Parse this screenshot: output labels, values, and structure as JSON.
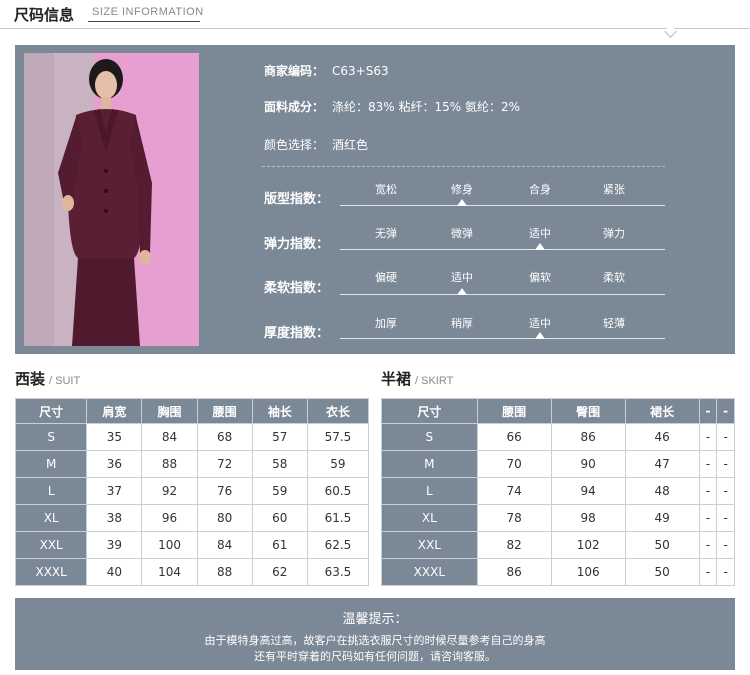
{
  "header": {
    "title": "尺码信息",
    "subtitle": "SIZE INFORMATION"
  },
  "product": {
    "code_label": "商家编码：",
    "code_value": "C63+S63",
    "fabric_label": "面料成分：",
    "fabric_value": "涤纶：83% 粘纤：15% 氨纶：2%",
    "color_label": "颜色选择：",
    "color_value": "酒红色"
  },
  "scales": [
    {
      "label": "版型指数：",
      "options": [
        "宽松",
        "修身",
        "合身",
        "紧张"
      ],
      "selected_index": 1
    },
    {
      "label": "弹力指数：",
      "options": [
        "无弹",
        "微弹",
        "适中",
        "弹力"
      ],
      "selected_index": 2
    },
    {
      "label": "柔软指数：",
      "options": [
        "偏硬",
        "适中",
        "偏软",
        "柔软"
      ],
      "selected_index": 1
    },
    {
      "label": "厚度指数：",
      "options": [
        "加厚",
        "稍厚",
        "适中",
        "轻薄"
      ],
      "selected_index": 2
    }
  ],
  "suit": {
    "title": "西装",
    "subtitle": "/ SUIT",
    "headers": [
      "尺寸",
      "肩宽",
      "胸围",
      "腰围",
      "袖长",
      "衣长"
    ],
    "rows": [
      [
        "S",
        "35",
        "84",
        "68",
        "57",
        "57.5"
      ],
      [
        "M",
        "36",
        "88",
        "72",
        "58",
        "59"
      ],
      [
        "L",
        "37",
        "92",
        "76",
        "59",
        "60.5"
      ],
      [
        "XL",
        "38",
        "96",
        "80",
        "60",
        "61.5"
      ],
      [
        "XXL",
        "39",
        "100",
        "84",
        "61",
        "62.5"
      ],
      [
        "XXXL",
        "40",
        "104",
        "88",
        "62",
        "63.5"
      ]
    ]
  },
  "skirt": {
    "title": "半裙",
    "subtitle": "/ SKIRT",
    "headers": [
      "尺寸",
      "腰围",
      "臀围",
      "裙长",
      "-",
      "-"
    ],
    "rows": [
      [
        "S",
        "66",
        "86",
        "46",
        "-",
        "-"
      ],
      [
        "M",
        "70",
        "90",
        "47",
        "-",
        "-"
      ],
      [
        "L",
        "74",
        "94",
        "48",
        "-",
        "-"
      ],
      [
        "XL",
        "78",
        "98",
        "49",
        "-",
        "-"
      ],
      [
        "XXL",
        "82",
        "102",
        "50",
        "-",
        "-"
      ],
      [
        "XXXL",
        "86",
        "106",
        "50",
        "-",
        "-"
      ]
    ]
  },
  "tip": {
    "title": "温馨提示：",
    "line1": "由于模特身高过高，故客户在挑选衣服尺寸的时候尽量参考自己的身高",
    "line2": "还有平时穿着的尺码如有任何问题，请咨询客服。"
  },
  "colors": {
    "panel": "#7b8896",
    "garment": "#5a1f33",
    "backdrop": "#e69fd0"
  }
}
